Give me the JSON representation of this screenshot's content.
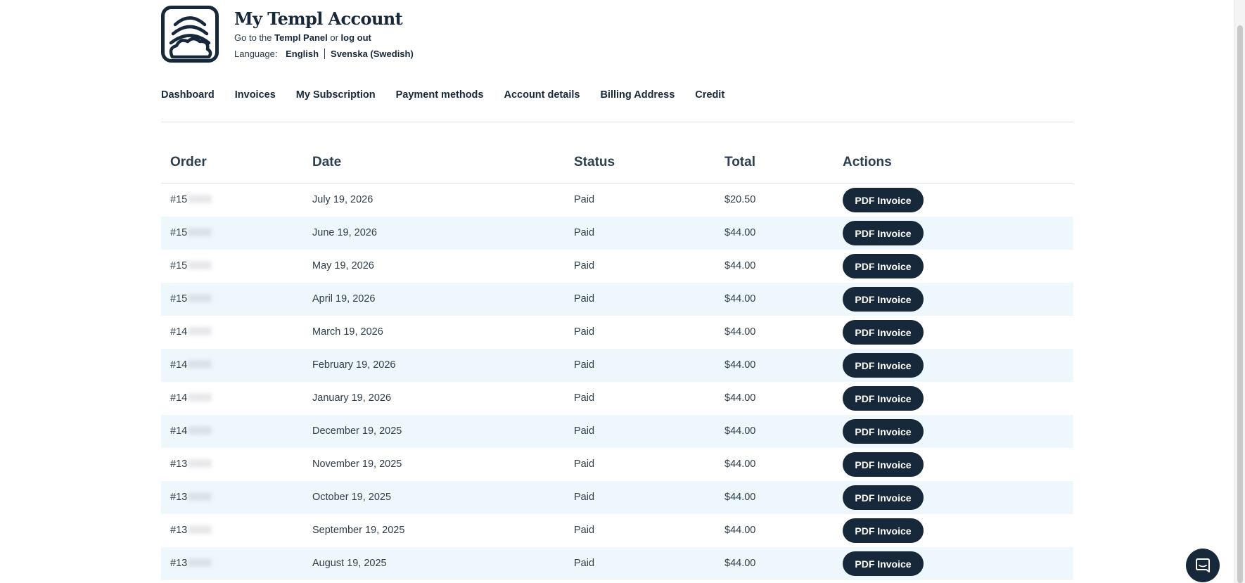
{
  "header": {
    "title": "My Templ Account",
    "goto_prefix": "Go to the",
    "panel_link": "Templ Panel",
    "or_text": "or",
    "logout_link": "log out",
    "language_label": "Language:",
    "languages": [
      "English",
      "Svenska (Swedish)"
    ]
  },
  "nav": [
    "Dashboard",
    "Invoices",
    "My Subscription",
    "Payment methods",
    "Account details",
    "Billing Address",
    "Credit"
  ],
  "table": {
    "headers": [
      "Order",
      "Date",
      "Status",
      "Total",
      "Actions"
    ],
    "rows": [
      {
        "order": "#15",
        "date": "July 19, 2026",
        "status": "Paid",
        "total": "$20.50",
        "action": "PDF Invoice"
      },
      {
        "order": "#15",
        "date": "June 19, 2026",
        "status": "Paid",
        "total": "$44.00",
        "action": "PDF Invoice"
      },
      {
        "order": "#15",
        "date": "May 19, 2026",
        "status": "Paid",
        "total": "$44.00",
        "action": "PDF Invoice"
      },
      {
        "order": "#15",
        "date": "April 19, 2026",
        "status": "Paid",
        "total": "$44.00",
        "action": "PDF Invoice"
      },
      {
        "order": "#14",
        "date": "March 19, 2026",
        "status": "Paid",
        "total": "$44.00",
        "action": "PDF Invoice"
      },
      {
        "order": "#14",
        "date": "February 19, 2026",
        "status": "Paid",
        "total": "$44.00",
        "action": "PDF Invoice"
      },
      {
        "order": "#14",
        "date": "January 19, 2026",
        "status": "Paid",
        "total": "$44.00",
        "action": "PDF Invoice"
      },
      {
        "order": "#14",
        "date": "December 19, 2025",
        "status": "Paid",
        "total": "$44.00",
        "action": "PDF Invoice"
      },
      {
        "order": "#13",
        "date": "November 19, 2025",
        "status": "Paid",
        "total": "$44.00",
        "action": "PDF Invoice"
      },
      {
        "order": "#13",
        "date": "October 19, 2025",
        "status": "Paid",
        "total": "$44.00",
        "action": "PDF Invoice"
      },
      {
        "order": "#13",
        "date": "September 19, 2025",
        "status": "Paid",
        "total": "$44.00",
        "action": "PDF Invoice"
      },
      {
        "order": "#13",
        "date": "August 19, 2025",
        "status": "Paid",
        "total": "$44.00",
        "action": "PDF Invoice"
      }
    ]
  },
  "icons": {
    "logo": "templ-cloud-logo-icon",
    "chat": "chat-bubble-icon"
  },
  "colors": {
    "brand_dark": "#16283a",
    "row_alt": "#eef8fc",
    "divider": "#dde2e7"
  }
}
